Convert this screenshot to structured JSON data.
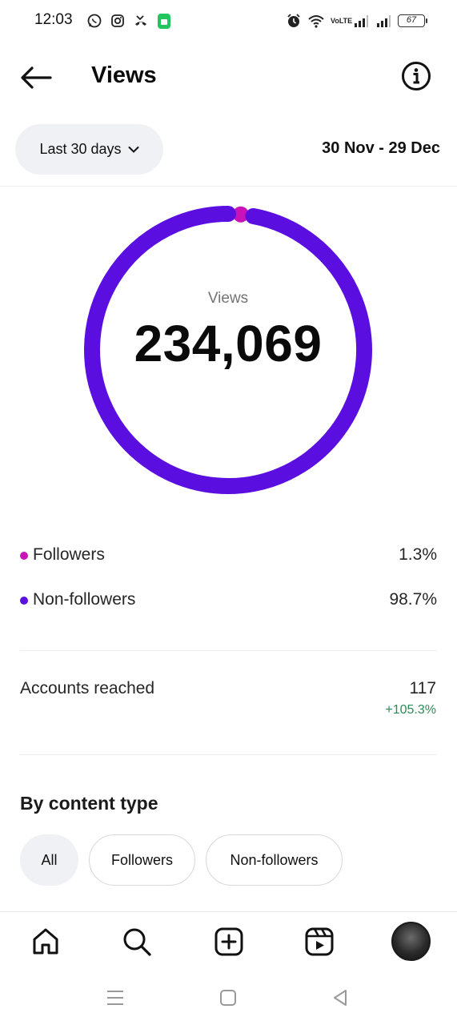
{
  "status_bar": {
    "time": "12:03",
    "battery": "67",
    "network_label": "VoLTE"
  },
  "header": {
    "title": "Views",
    "back_icon": "arrow-left-icon",
    "info_icon": "info-icon"
  },
  "filters": {
    "range_label": "Last 30 days",
    "date_range": "30 Nov - 29 Dec"
  },
  "donut": {
    "label": "Views",
    "value": "234,069",
    "segments": [
      {
        "name": "Followers",
        "percent": 1.3,
        "color": "#c913b9"
      },
      {
        "name": "Non-followers",
        "percent": 98.7,
        "color": "#5a0fe0"
      }
    ]
  },
  "breakdown": [
    {
      "label": "Followers",
      "value": "1.3%",
      "color": "#c913b9"
    },
    {
      "label": "Non-followers",
      "value": "98.7%",
      "color": "#5a0fe0"
    }
  ],
  "reach": {
    "label": "Accounts reached",
    "value": "117",
    "change": "+105.3%"
  },
  "content_type": {
    "title": "By content type",
    "chips": [
      "All",
      "Followers",
      "Non-followers"
    ],
    "selected": "All"
  },
  "bottom_nav": [
    "home-icon",
    "search-icon",
    "create-icon",
    "reels-icon",
    "profile-avatar"
  ],
  "system_nav": [
    "menu-icon",
    "home-square-icon",
    "back-triangle-icon"
  ]
}
